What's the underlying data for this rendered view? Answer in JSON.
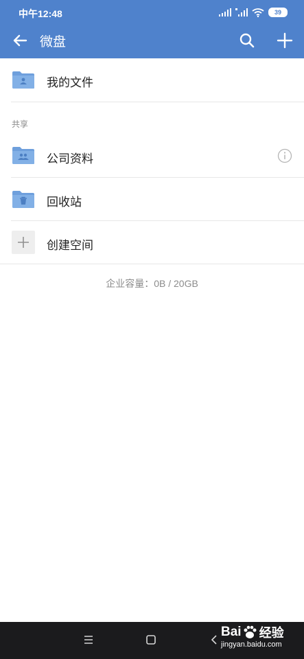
{
  "status_bar": {
    "time": "中午12:48",
    "battery": "39"
  },
  "app_bar": {
    "title": "微盘"
  },
  "items": {
    "my_files": "我的文件",
    "section_shared": "共享",
    "company_data": "公司资料",
    "recycle_bin": "回收站",
    "create_space": "创建空间"
  },
  "footer": {
    "capacity": "企业容量：0B / 20GB"
  },
  "watermark": {
    "brand": "Bai",
    "brand2": "经验",
    "url": "jingyan.baidu.com"
  },
  "colors": {
    "primary": "#4f82cc",
    "folder": "#6e9fdc"
  },
  "icons": {
    "back": "arrow-left-icon",
    "search": "search-icon",
    "add": "plus-icon",
    "info": "info-icon"
  }
}
